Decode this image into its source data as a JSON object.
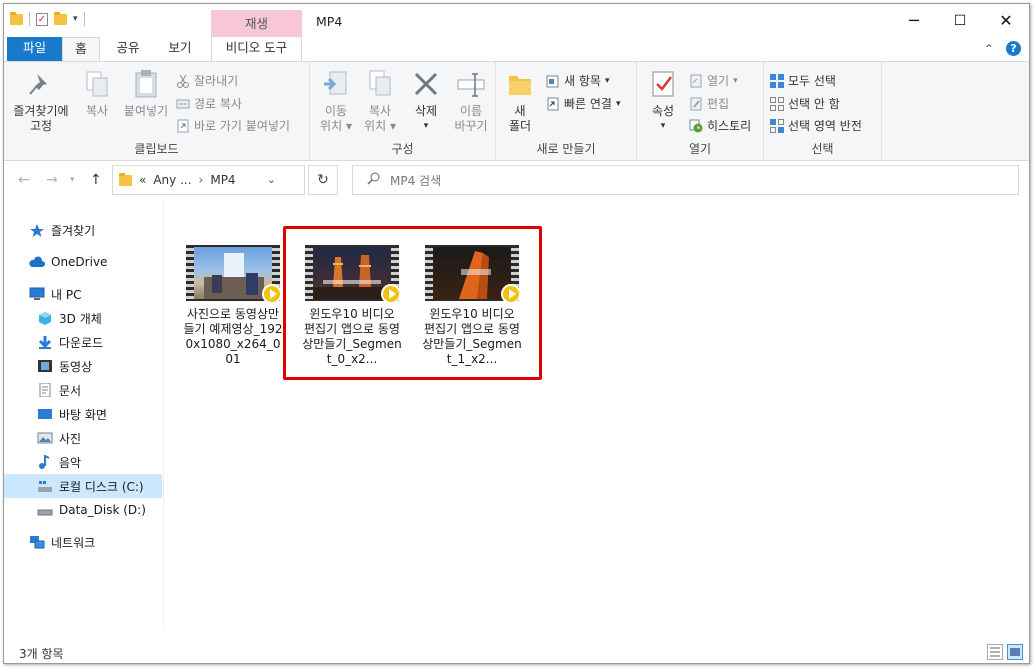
{
  "window": {
    "title": "MP4",
    "contextual_tab": "재생",
    "minimize": "─",
    "maximize": "☐",
    "close": "✕"
  },
  "tabs": {
    "file": "파일",
    "home": "홈",
    "share": "공유",
    "view": "보기",
    "video_tools": "비디오 도구"
  },
  "ribbon": {
    "clipboard": {
      "label": "클립보드",
      "pin_line1": "즐겨찾기에",
      "pin_line2": "고정",
      "copy": "복사",
      "paste": "붙여넣기",
      "cut": "잘라내기",
      "copy_path": "경로 복사",
      "paste_shortcut": "바로 가기 붙여넣기"
    },
    "organize": {
      "label": "구성",
      "move_line1": "이동",
      "move_line2": "위치",
      "copy_line1": "복사",
      "copy_line2": "위치",
      "delete": "삭제",
      "rename_line1": "이름",
      "rename_line2": "바꾸기"
    },
    "new": {
      "label": "새로 만들기",
      "folder_line1": "새",
      "folder_line2": "폴더",
      "new_item": "새 항목",
      "easy_access": "빠른 연결"
    },
    "open": {
      "label": "열기",
      "properties": "속성",
      "open": "열기",
      "edit": "편집",
      "history": "히스토리"
    },
    "select": {
      "label": "선택",
      "select_all": "모두 선택",
      "select_none": "선택 안 함",
      "invert": "선택 영역 반전"
    }
  },
  "address": {
    "crumb_prefix": "«",
    "crumb1": "Any ...",
    "crumb_sep": "›",
    "crumb2": "MP4",
    "search_placeholder": "MP4 검색"
  },
  "nav": {
    "items": [
      {
        "label": "즐겨찾기"
      },
      {
        "label": "OneDrive"
      },
      {
        "label": "내 PC"
      },
      {
        "label": "3D 개체"
      },
      {
        "label": "다운로드"
      },
      {
        "label": "동영상"
      },
      {
        "label": "문서"
      },
      {
        "label": "바탕 화면"
      },
      {
        "label": "사진"
      },
      {
        "label": "음악"
      },
      {
        "label": "로컬 디스크 (C:)"
      },
      {
        "label": "Data_Disk (D:)"
      },
      {
        "label": "네트워크"
      }
    ]
  },
  "files": [
    {
      "name": "사진으로 동영상만들기 예제영상_1920x1080_x264_001"
    },
    {
      "name": "윈도우10 비디오 편집기 앱으로 동영상만들기_Segment_0_x2..."
    },
    {
      "name": "윈도우10 비디오 편집기 앱으로 동영상만들기_Segment_1_x2..."
    }
  ],
  "status": {
    "item_count": "3개 항목"
  },
  "colors": {
    "accent": "#1979ca",
    "contextual_tab": "#f7c7d9",
    "highlight_box": "#e00000",
    "selection": "#cce8ff",
    "play_badge": "#f4c20d"
  }
}
